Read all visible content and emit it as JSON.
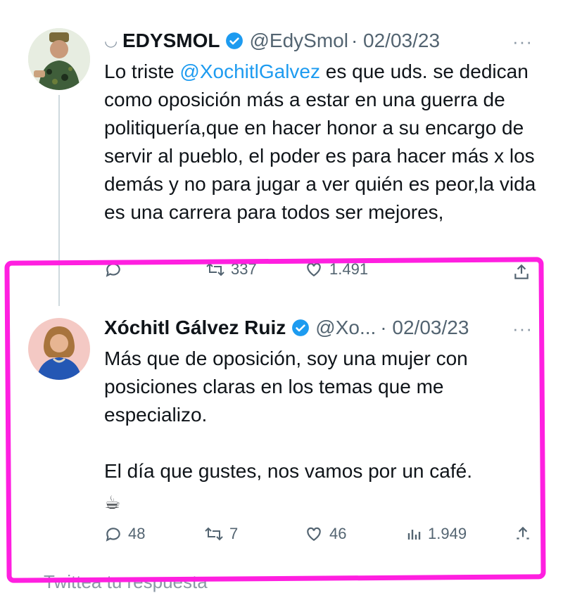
{
  "tweet1": {
    "name": "EDYSMOL",
    "handle": "@EdySmol",
    "date": "· 02/03/23",
    "more": "···",
    "text_before_mention": "Lo triste ",
    "mention": "@XochitlGalvez",
    "text_after_mention": " es que uds. se dedican como oposición más a estar en una guerra de politiquería,que en hacer honor a su encargo de servir al pueblo, el poder es para hacer más x los demás y no para jugar a ver quién es peor,la vida es una carrera para todos ser mejores,",
    "actions": {
      "retweets": "337",
      "likes": "1.491"
    }
  },
  "tweet2": {
    "name": "Xóchitl Gálvez Ruiz",
    "handle": "@Xo...",
    "date": "· 02/03/23",
    "more": "···",
    "paragraph1": "Más que de oposición, soy una mujer con posiciones claras en los temas que me especializo.",
    "paragraph2": "El día que gustes, nos vamos por un café.",
    "emoji": "☕",
    "actions": {
      "replies": "48",
      "retweets": "7",
      "likes": "46",
      "views": "1.949"
    }
  },
  "reply_prompt": "Twittea tu respuesta",
  "colors": {
    "mention": "#1d9bf0",
    "highlight": "#ff1fe0",
    "muted": "#536471"
  }
}
